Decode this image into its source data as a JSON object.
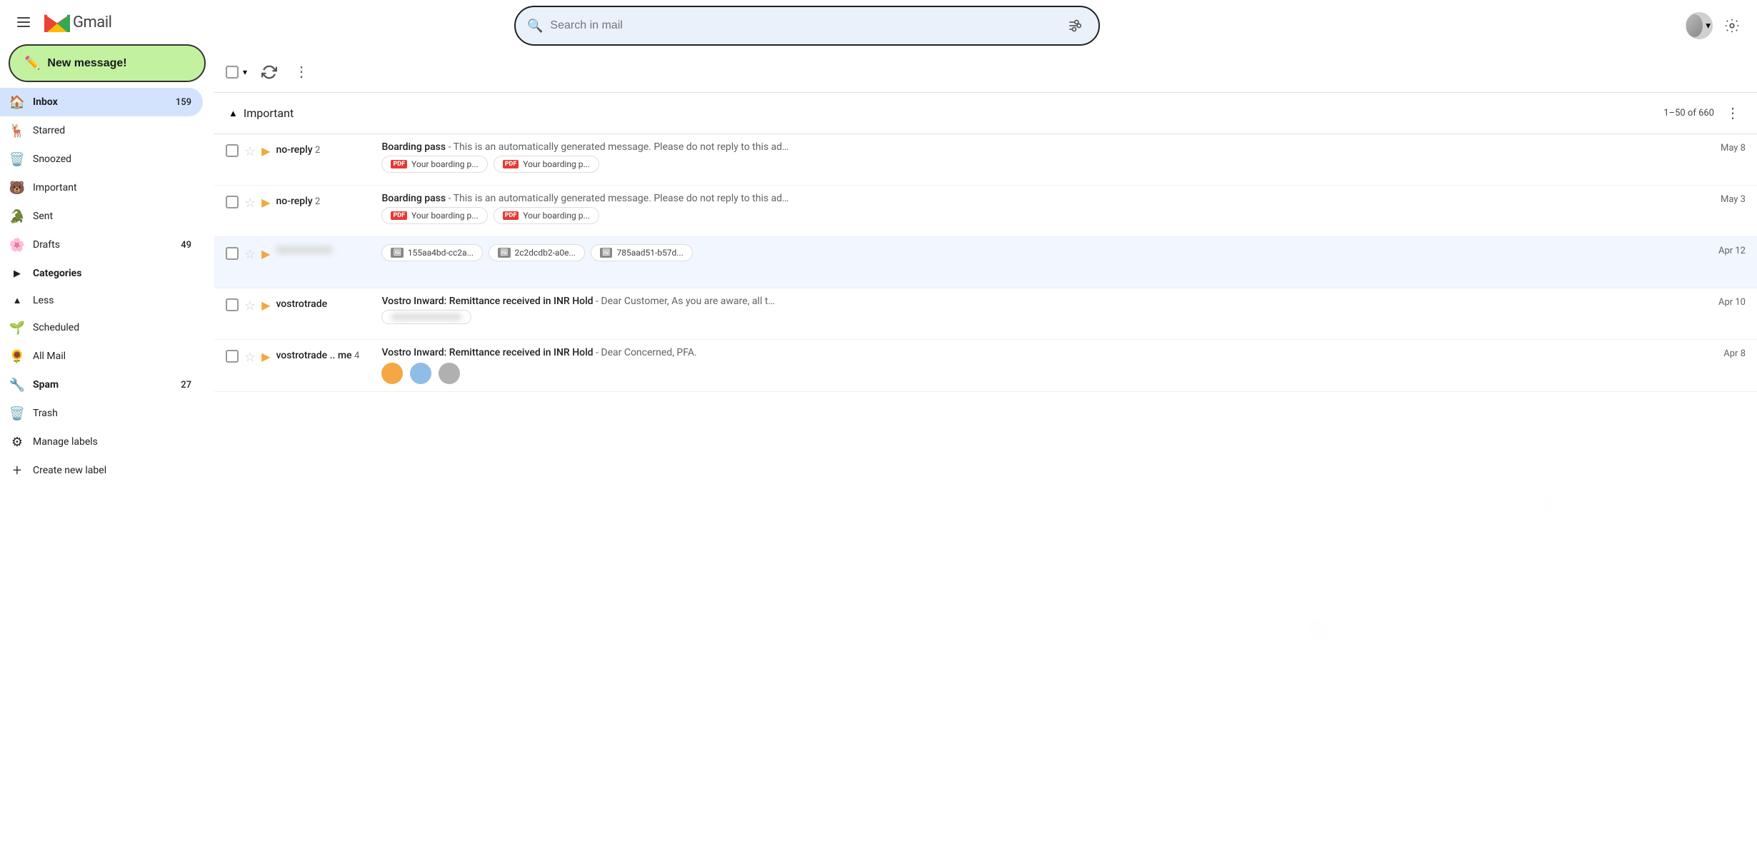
{
  "sidebar": {
    "hamburger_label": "Main menu",
    "gmail_text": "Gmail",
    "new_message_label": "New message!",
    "nav_items": [
      {
        "id": "inbox",
        "label": "Inbox",
        "badge": "159",
        "icon": "🏠",
        "active": true
      },
      {
        "id": "starred",
        "label": "Starred",
        "icon": "🦌",
        "active": false
      },
      {
        "id": "snoozed",
        "label": "Snoozed",
        "icon": "🗑️",
        "active": false
      },
      {
        "id": "important",
        "label": "Important",
        "icon": "🐻",
        "active": false
      },
      {
        "id": "sent",
        "label": "Sent",
        "icon": "🐊",
        "active": false
      },
      {
        "id": "drafts",
        "label": "Drafts",
        "badge": "49",
        "icon": "🌸",
        "active": false
      },
      {
        "id": "categories",
        "label": "Categories",
        "icon": "▶",
        "active": false
      },
      {
        "id": "less",
        "label": "Less",
        "icon": "▲",
        "section": true
      },
      {
        "id": "scheduled",
        "label": "Scheduled",
        "icon": "🌱",
        "active": false
      },
      {
        "id": "all_mail",
        "label": "All Mail",
        "icon": "🌻",
        "active": false
      },
      {
        "id": "spam",
        "label": "Spam",
        "badge": "27",
        "icon": "🔧",
        "active": false
      },
      {
        "id": "trash",
        "label": "Trash",
        "icon": "🗑️",
        "active": false
      },
      {
        "id": "manage_labels",
        "label": "Manage labels",
        "icon": "⚙",
        "active": false
      },
      {
        "id": "create_new_label",
        "label": "Create new label",
        "icon": "+",
        "active": false
      }
    ]
  },
  "search": {
    "placeholder": "Search in mail"
  },
  "toolbar": {
    "select_all_label": "Select all",
    "refresh_label": "Refresh",
    "more_options_label": "More options"
  },
  "email_list": {
    "section_title": "Important",
    "section_count": "1–50 of 660",
    "emails": [
      {
        "id": 1,
        "sender": "no-reply",
        "sender_count": "2",
        "subject": "Boarding pass",
        "preview": "- This is an automatically generated message. Please do not reply to this ad…",
        "date": "May 8",
        "attachments": [
          {
            "type": "pdf",
            "label": "Your boarding p..."
          },
          {
            "type": "pdf",
            "label": "Your boarding p..."
          }
        ]
      },
      {
        "id": 2,
        "sender": "no-reply",
        "sender_count": "2",
        "subject": "Boarding pass",
        "preview": "- This is an automatically generated message. Please do not reply to this ad…",
        "date": "May 3",
        "attachments": [
          {
            "type": "pdf",
            "label": "Your boarding p..."
          },
          {
            "type": "pdf",
            "label": "Your boarding p..."
          }
        ]
      },
      {
        "id": 3,
        "sender": "",
        "sender_count": "",
        "subject": "",
        "preview": "",
        "date": "Apr 12",
        "blurred_sender": true,
        "attachments": [
          {
            "type": "img",
            "label": "155aa4bd-cc2a..."
          },
          {
            "type": "img",
            "label": "2c2dcdb2-a0e..."
          },
          {
            "type": "img",
            "label": "785aad51-b57d..."
          }
        ]
      },
      {
        "id": 4,
        "sender": "vostrotrade",
        "sender_count": "",
        "subject": "Vostro Inward: Remittance received in INR Hold",
        "preview": "- Dear Customer, As you are aware, all t…",
        "date": "Apr 10",
        "attachments": [
          {
            "type": "blurred",
            "label": ""
          }
        ]
      },
      {
        "id": 5,
        "sender": "vostrotrade .. me",
        "sender_count": "4",
        "subject": "Vostro Inward: Remittance received in INR Hold",
        "preview": "- Dear Concerned, PFA.",
        "date": "Apr 8",
        "attachments": [
          {
            "type": "color_dot",
            "color": "#f4a742"
          },
          {
            "type": "color_dot",
            "color": "#90bce8"
          },
          {
            "type": "color_dot",
            "color": "#b0b0b0"
          }
        ]
      }
    ]
  },
  "icons": {
    "search": "🔍",
    "filter": "≡",
    "settings": "⚙",
    "pencil": "✏",
    "chevron_down": "▾",
    "more_vert": "⋮",
    "refresh": "↻",
    "collapse_arrow": "▲",
    "expand_arrow": "▶"
  }
}
